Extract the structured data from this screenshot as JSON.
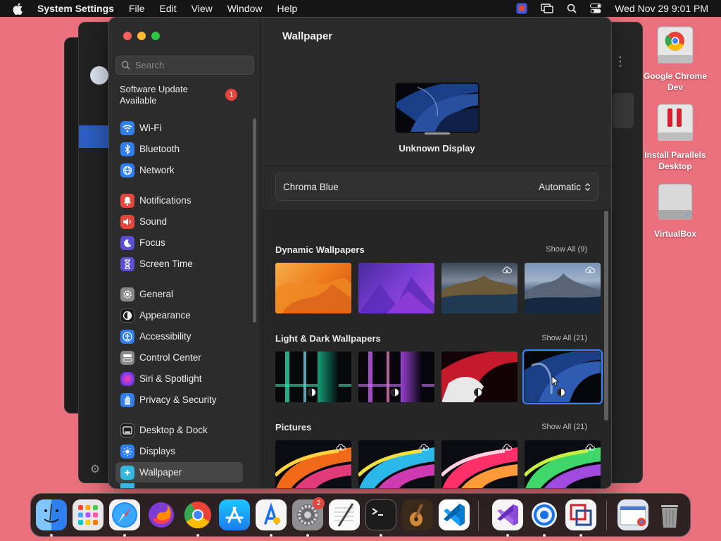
{
  "menubar": {
    "app_name": "System Settings",
    "menus": [
      "File",
      "Edit",
      "View",
      "Window",
      "Help"
    ],
    "clock": "Wed Nov 29  9:01 PM"
  },
  "sidebar": {
    "search_placeholder": "Search",
    "update": {
      "label": "Software Update Available",
      "count": "1"
    },
    "items": [
      {
        "label": "Wi-Fi",
        "icon": "wifi-icon",
        "color": "#2f7ff0"
      },
      {
        "label": "Bluetooth",
        "icon": "bluetooth-icon",
        "color": "#2f7ff0"
      },
      {
        "label": "Network",
        "icon": "globe-icon",
        "color": "#2f7ff0"
      },
      {
        "label": "Notifications",
        "icon": "bell-icon",
        "color": "#e5453a"
      },
      {
        "label": "Sound",
        "icon": "speaker-icon",
        "color": "#e5453a"
      },
      {
        "label": "Focus",
        "icon": "moon-icon",
        "color": "#5b4fd8"
      },
      {
        "label": "Screen Time",
        "icon": "hourglass-icon",
        "color": "#5b4fd8"
      },
      {
        "label": "General",
        "icon": "gear-icon",
        "color": "#8a8a8a"
      },
      {
        "label": "Appearance",
        "icon": "appearance-icon",
        "color": "#1c1c1c"
      },
      {
        "label": "Accessibility",
        "icon": "accessibility-icon",
        "color": "#2f7ff0"
      },
      {
        "label": "Control Center",
        "icon": "control-center-icon",
        "color": "#8a8a8a"
      },
      {
        "label": "Siri & Spotlight",
        "icon": "siri-icon",
        "color": "#b23fd6"
      },
      {
        "label": "Privacy & Security",
        "icon": "hand-icon",
        "color": "#2f7ff0"
      },
      {
        "label": "Desktop & Dock",
        "icon": "dock-icon",
        "color": "#1c1c1c"
      },
      {
        "label": "Displays",
        "icon": "sun-icon",
        "color": "#2f7ff0"
      },
      {
        "label": "Wallpaper",
        "icon": "wallpaper-icon",
        "color": "#36b7e0"
      }
    ],
    "selected": "Wallpaper"
  },
  "content": {
    "title": "Wallpaper",
    "display_name": "Unknown Display",
    "picker": {
      "wallpaper": "Chroma Blue",
      "mode": "Automatic"
    },
    "sections": [
      {
        "title": "Dynamic Wallpapers",
        "show_all": "Show All (9)"
      },
      {
        "title": "Light & Dark Wallpapers",
        "show_all": "Show All (21)"
      },
      {
        "title": "Pictures",
        "show_all": "Show All (21)"
      }
    ]
  },
  "desktop": {
    "icons": [
      {
        "label": "Google Chrome Dev"
      },
      {
        "label": "Install Parallels Desktop"
      },
      {
        "label": "VirtualBox"
      }
    ]
  },
  "dock": {
    "apps": [
      "Finder",
      "Launchpad",
      "Safari",
      "Firefox",
      "Google Chrome",
      "App Store",
      "Xcode Instruments",
      "System Settings",
      "TextEdit",
      "Terminal",
      "GarageBand",
      "Visual Studio Code",
      "Visual Studio",
      "Chrome Remote",
      "Parallels",
      "Preview",
      "Trash"
    ],
    "settings_badge": "2"
  }
}
